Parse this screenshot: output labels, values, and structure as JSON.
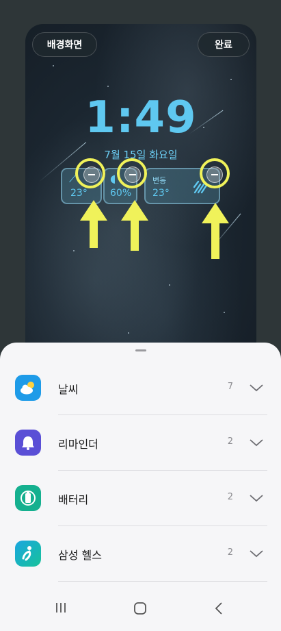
{
  "preview": {
    "wallpaper_button": "배경화면",
    "done_button": "완료",
    "time": "1:49",
    "date": "7월 15일 화요일",
    "widgets": [
      {
        "value": "23°",
        "icon": "weather-wind-icon"
      },
      {
        "value": "60%",
        "icon": "weather-humidity-icon"
      },
      {
        "label": "변동",
        "value": "23°",
        "icon": "rain-icon"
      }
    ]
  },
  "sheet": {
    "items": [
      {
        "label": "날씨",
        "count": "7",
        "icon": "weather-app-icon",
        "color": "#1e9be8"
      },
      {
        "label": "리마인더",
        "count": "2",
        "icon": "reminder-app-icon",
        "color": "#5a4fd6"
      },
      {
        "label": "배터리",
        "count": "2",
        "icon": "battery-app-icon",
        "color": "#15b08f"
      },
      {
        "label": "삼성 헬스",
        "count": "2",
        "icon": "samsung-health-app-icon",
        "color": "#1aa6e0"
      }
    ]
  },
  "annotations": {
    "highlight_color": "#f0f25a"
  },
  "navbar": {
    "buttons": [
      "recent-apps-icon",
      "home-icon",
      "back-icon"
    ]
  }
}
